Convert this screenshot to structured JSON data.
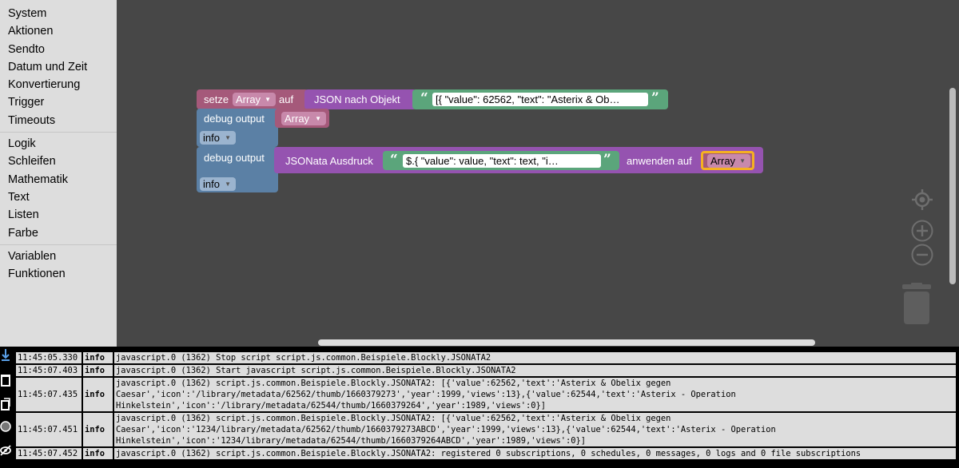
{
  "toolbox": {
    "groups": [
      [
        "System",
        "Aktionen",
        "Sendto",
        "Datum und Zeit",
        "Konvertierung",
        "Trigger",
        "Timeouts"
      ],
      [
        "Logik",
        "Schleifen",
        "Mathematik",
        "Text",
        "Listen",
        "Farbe"
      ],
      [
        "Variablen",
        "Funktionen"
      ]
    ]
  },
  "blocks": {
    "set_label": "setze",
    "set_var": "Array",
    "set_to": "auf",
    "json_label": "JSON nach Objekt",
    "json_value": "[{     \"value\": 62562,     \"text\": \"Asterix & Ob…",
    "debug1_label": "debug output",
    "debug1_value": "Array",
    "debug1_level": "info",
    "debug2_label": "debug output",
    "debug2_level": "info",
    "jsonata_label": "JSONata Ausdruck",
    "jsonata_value": "$.{     \"value\": value,     \"text\": text,     \"i…",
    "apply_label": "anwenden auf",
    "apply_var": "Array"
  },
  "colors": {
    "workspace": "#474747",
    "variable": "#a5597a",
    "conversion": "#9553b0",
    "debug": "#5b80a5",
    "text": "#5ba57b",
    "highlight": "#f5b121"
  },
  "controls": {
    "center_icon": "crosshair-icon",
    "zoom_in_icon": "plus-icon",
    "zoom_out_icon": "minus-icon",
    "trash_icon": "trash-icon"
  },
  "log": {
    "rows": [
      {
        "time": "11:45:05.330",
        "severity": "info",
        "message": "javascript.0 (1362) Stop script script.js.common.Beispiele.Blockly.JSONATA2"
      },
      {
        "time": "11:45:07.403",
        "severity": "info",
        "message": "javascript.0 (1362) Start javascript script.js.common.Beispiele.Blockly.JSONATA2"
      },
      {
        "time": "11:45:07.435",
        "severity": "info",
        "message": "javascript.0 (1362) script.js.common.Beispiele.Blockly.JSONATA2: [{'value':62562,'text':'Asterix & Obelix gegen Caesar','icon':'/library/metadata/62562/thumb/1660379273','year':1999,'views':13},{'value':62544,'text':'Asterix - Operation Hinkelstein','icon':'/library/metadata/62544/thumb/1660379264','year':1989,'views':0}]"
      },
      {
        "time": "11:45:07.451",
        "severity": "info",
        "message": "javascript.0 (1362) script.js.common.Beispiele.Blockly.JSONATA2: [{'value':62562,'text':'Asterix & Obelix gegen Caesar','icon':'1234/library/metadata/62562/thumb/1660379273ABCD','year':1999,'views':13},{'value':62544,'text':'Asterix - Operation Hinkelstein','icon':'1234/library/metadata/62544/thumb/1660379264ABCD','year':1989,'views':0}]"
      },
      {
        "time": "11:45:07.452",
        "severity": "info",
        "message": "javascript.0 (1362) script.js.common.Beispiele.Blockly.JSONATA2: registered 0 subscriptions, 0 schedules, 0 messages, 0 logs and 0 file subscriptions"
      }
    ]
  }
}
